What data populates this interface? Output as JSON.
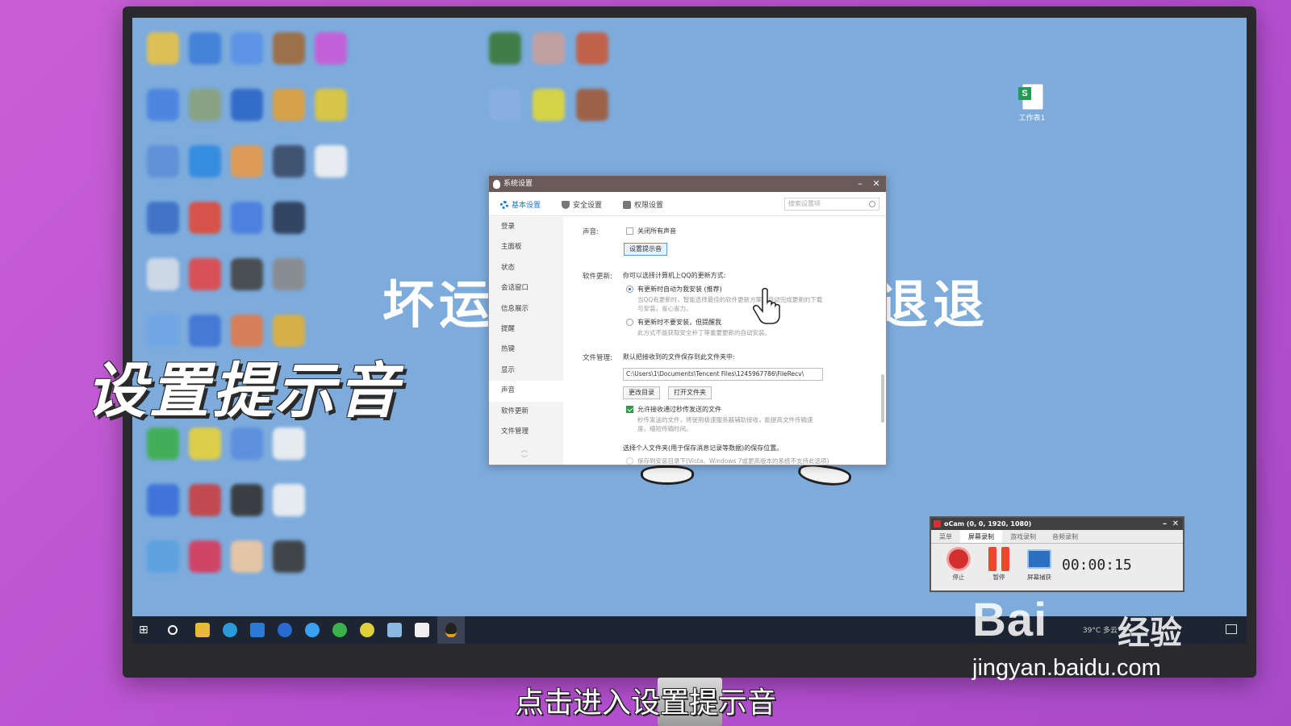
{
  "overlay": {
    "bg_left": "坏运",
    "bg_right": "退退",
    "big_caption": "设置提示音",
    "subtitle": "点击进入设置提示音",
    "watermark": "Bai经验",
    "watermark_left": "Bai",
    "watermark_right": "经验",
    "watermark_url": "jingyan.baidu.com"
  },
  "desktop": {
    "sheet_icon_label": "工作表1"
  },
  "dialog": {
    "title": "系统设置",
    "minimize": "–",
    "close": "✕",
    "tabs": [
      {
        "label": "基本设置",
        "icon": "gear-icon",
        "active": true
      },
      {
        "label": "安全设置",
        "icon": "shield-icon"
      },
      {
        "label": "权限设置",
        "icon": "lock-icon"
      }
    ],
    "search_placeholder": "搜索设置项",
    "sidebar": [
      "登录",
      "主面板",
      "状态",
      "会话窗口",
      "信息展示",
      "提醒",
      "热键",
      "显示",
      "声音",
      "软件更新",
      "文件管理"
    ],
    "sidebar_active": "声音",
    "sound": {
      "label": "声音:",
      "mute_all": "关闭所有声音",
      "set_tone_button": "设置提示音"
    },
    "update": {
      "label": "软件更新:",
      "intro": "你可以选择计算机上QQ的更新方式:",
      "opt1": "有更新时自动为我安装 (推荐)",
      "opt1_desc_1": "当QQ有更新时，智能选择最佳的软件更新方案，自动完成更新的下载",
      "opt1_desc_2": "与安装，省心省力。",
      "opt2": "有更新时不要安装，但提醒我",
      "opt2_desc": "此方式不能获取安全补丁等重要更新的自动安装。"
    },
    "files": {
      "label": "文件管理:",
      "default_save": "默认把接收到的文件保存到此文件夹中:",
      "path": "C:\\Users\\1\\Documents\\Tencent Files\\1245967786\\FileRecv\\",
      "change_dir": "更改目录",
      "open_folder": "打开文件夹",
      "allow_second": "允许接收通过秒传发送的文件",
      "allow_desc_1": "秒传发送的文件，将使用极速服务器辅助接收，能提高文件传输速",
      "allow_desc_2": "度，缩短传输时间。",
      "personal_folder": "选择个人文件夹(用于保存消息记录等数据)的保存位置。",
      "save_install_dir": "保存到安装目录下(Vista、Windows 7或更高版本的系统不支持此选项)"
    }
  },
  "ocam": {
    "title": "oCam (0, 0, 1920, 1080)",
    "tabs": [
      "菜单",
      "屏幕录制",
      "游戏录制",
      "音频录制"
    ],
    "active_tab": "屏幕录制",
    "stop": "停止",
    "pause": "暂停",
    "capture": "屏幕捕获",
    "timer": "00:00:15"
  },
  "taskbar": {
    "tray_text": "39°C 多云"
  },
  "colors": {
    "background": "#c95fd6",
    "desktop": "#7cabdc",
    "dialog_title": "#6b5a5a",
    "accent": "#1e78c8"
  }
}
